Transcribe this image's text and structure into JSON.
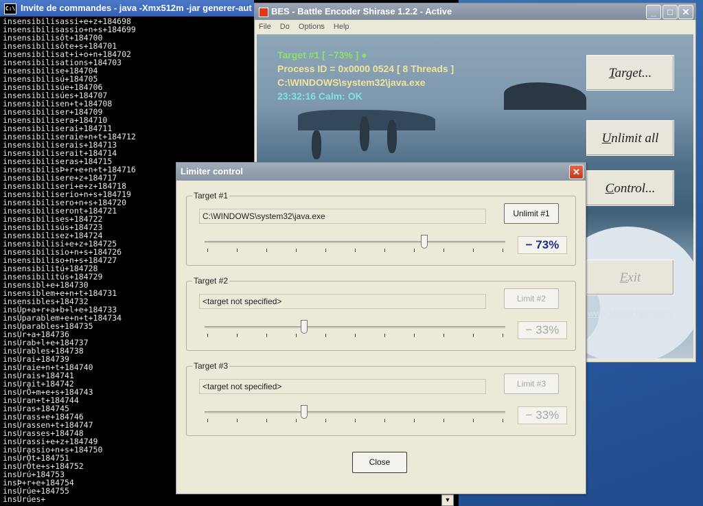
{
  "console": {
    "title": "Invite de commandes - java -Xmx512m -jar generer-aut",
    "icon_text": "C:\\",
    "lines": [
      "insensibilisassi+e+z+184698",
      "insensibilisassio+n+s+184699",
      "insensibilisôt+184700",
      "insensibilisôte+s+184701",
      "insensibilisat+i+o+n+184702",
      "insensibilisations+184703",
      "insensibilise+184704",
      "insensibilisú+184705",
      "insensibilisúe+184706",
      "insensibilisúes+184707",
      "insensibilisen+t+184708",
      "insensibiliser+184709",
      "insensibilisera+184710",
      "insensibiliserai+184711",
      "insensibiliseraie+n+t+184712",
      "insensibiliserais+184713",
      "insensibiliserait+184714",
      "insensibiliseras+184715",
      "insensibilisÞ+r+e+n+t+184716",
      "insensibilisere+z+184717",
      "insensibiliseri+e+z+184718",
      "insensibiliserio+n+s+184719",
      "insensibilisero+n+s+184720",
      "insensibiliseront+184721",
      "insensibilises+184722",
      "insensibilisús+184723",
      "insensibilisez+184724",
      "insensibilisi+e+z+184725",
      "insensibilisio+n+s+184726",
      "insensibiliso+n+s+184727",
      "insensibilitú+184728",
      "insensibilitús+184729",
      "insensibl+e+184730",
      "insensiblem+e+n+t+184731",
      "insensibles+184732",
      "insÚp+a+r+a+b+l+e+184733",
      "insÚparablem+e+n+t+184734",
      "insÚparables+184735",
      "insÚr+a+184736",
      "insÚrab+l+e+184737",
      "insÚrables+184738",
      "insÚrai+184739",
      "insÚraie+n+t+184740",
      "insÚrais+184741",
      "insÚrait+184742",
      "insÚrÔ+m+e+s+184743",
      "insÚran+t+184744",
      "insÚras+184745",
      "insÚrass+e+184746",
      "insÚrassen+t+184747",
      "insÚrasses+184748",
      "insÚrassi+e+z+184749",
      "insÚrassio+n+s+184750",
      "insÚrÔt+184751",
      "insÚrÔte+s+184752",
      "insÚrú+184753",
      "insÞ+r+e+184754",
      "insÚrúe+184755",
      "insÚrúes+"
    ],
    "scroll_glyph": "▼"
  },
  "bes": {
    "title": "BES - Battle Encoder Shirase 1.2.2 - Active",
    "min_glyph": "_",
    "max_glyph": "□",
    "close_glyph": "✕",
    "menu": [
      "File",
      "Do",
      "Options",
      "Help"
    ],
    "info": {
      "target_line": "Target #1 [ −73% ] ●",
      "process_line": "Process ID = 0x0000 0524 [ 8 Threads ]",
      "path_line": "C:\\WINDOWS\\system32\\java.exe",
      "status_line": "23:32:16 Calm: OK"
    },
    "buttons": {
      "target": {
        "pre": "",
        "key": "T",
        "rest": "arget..."
      },
      "unlimit_all": {
        "pre": "",
        "key": "U",
        "rest": "nlimit all"
      },
      "control": {
        "pre": "",
        "key": "C",
        "rest": "ontrol..."
      },
      "exit": {
        "pre": "",
        "key": "E",
        "rest": "xit"
      }
    },
    "link": "www.faireal.net/mion/"
  },
  "dialog": {
    "title": "Limiter control",
    "close_glyph": "✕",
    "close_button": "Close",
    "groups": [
      {
        "label": "Target #1",
        "path": "C:\\WINDOWS\\system32\\java.exe",
        "button": "Unlimit #1",
        "percent_text": "− 73%",
        "level": 73,
        "enabled": true
      },
      {
        "label": "Target #2",
        "path": "<target not specified>",
        "button": "Limit #2",
        "percent_text": "− 33%",
        "level": 33,
        "enabled": false
      },
      {
        "label": "Target #3",
        "path": "<target not specified>",
        "button": "Limit #3",
        "percent_text": "− 33%",
        "level": 33,
        "enabled": false
      }
    ]
  },
  "colors": {
    "info_target": "#8ee06a",
    "info_process": "#f2e39a",
    "info_status": "#7fe3e0",
    "percent_active": "#1a2e8a"
  }
}
